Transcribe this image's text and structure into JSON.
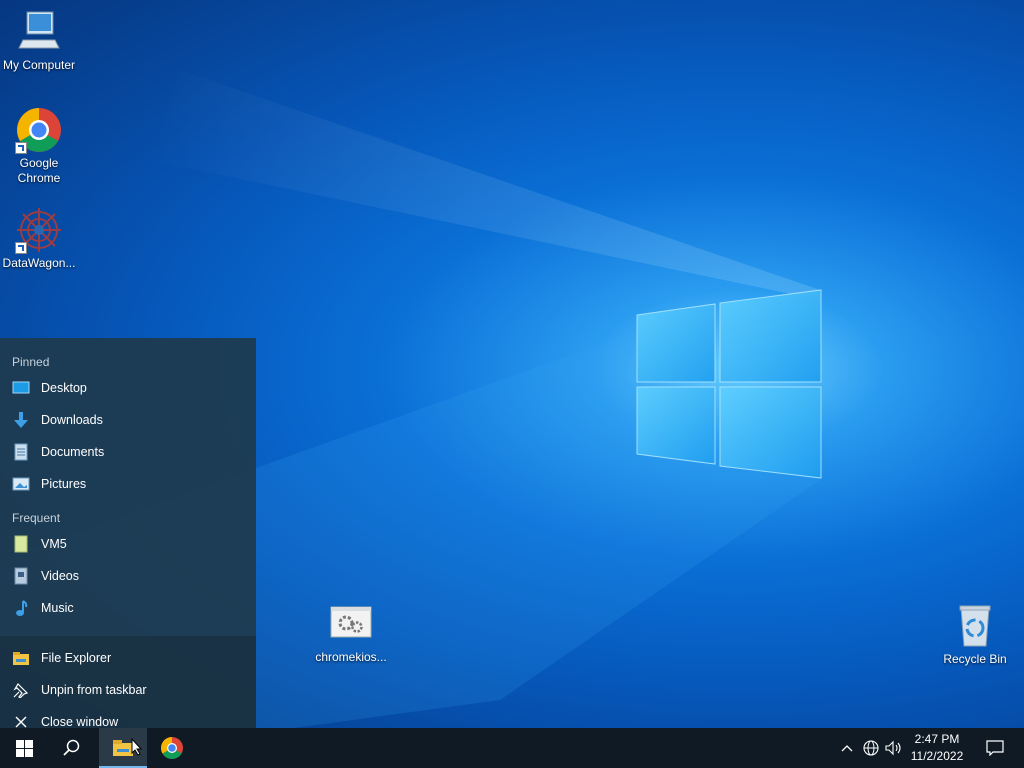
{
  "desktop": {
    "icons": [
      {
        "label": "My Computer",
        "icon": "computer-icon"
      },
      {
        "label": "Google Chrome",
        "icon": "chrome-icon"
      },
      {
        "label": "DataWagon...",
        "icon": "datawagon-icon"
      },
      {
        "label": "chromekios...",
        "icon": "settings-file-icon"
      },
      {
        "label": "Recycle Bin",
        "icon": "recycle-bin-icon"
      }
    ]
  },
  "jumplist": {
    "pinned_header": "Pinned",
    "pinned": [
      {
        "label": "Desktop",
        "icon": "desktop-folder-icon"
      },
      {
        "label": "Downloads",
        "icon": "download-arrow-icon"
      },
      {
        "label": "Documents",
        "icon": "document-icon"
      },
      {
        "label": "Pictures",
        "icon": "pictures-icon"
      }
    ],
    "frequent_header": "Frequent",
    "frequent": [
      {
        "label": "VM5",
        "icon": "folder-icon"
      },
      {
        "label": "Videos",
        "icon": "videos-icon"
      },
      {
        "label": "Music",
        "icon": "music-note-icon"
      }
    ],
    "actions": [
      {
        "label": "File Explorer",
        "icon": "file-explorer-icon"
      },
      {
        "label": "Unpin from taskbar",
        "icon": "unpin-icon"
      },
      {
        "label": "Close window",
        "icon": "close-icon"
      }
    ]
  },
  "taskbar": {
    "clock_time": "2:47 PM",
    "clock_date": "11/2/2022"
  },
  "colors": {
    "accent": "#0078d7",
    "taskbar_bg": "#0f1a24",
    "jumplist_bg": "#1e3a4e"
  }
}
